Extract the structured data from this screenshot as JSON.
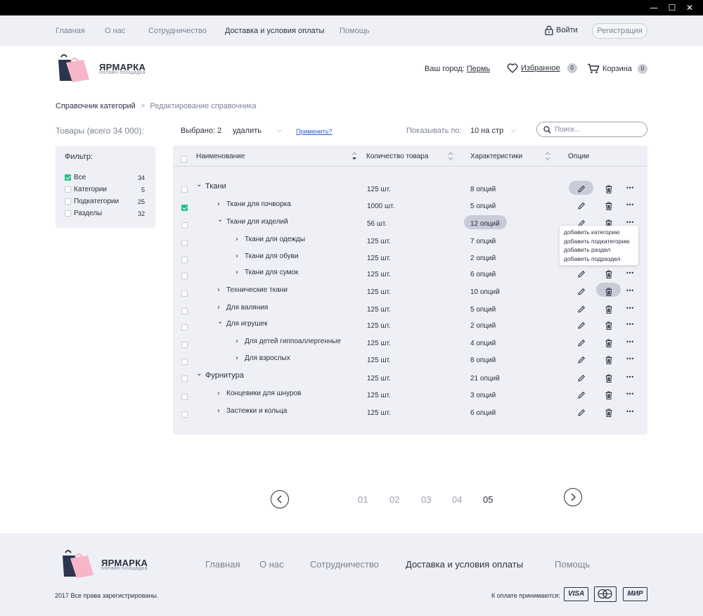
{
  "window": {
    "min_glyph": "—",
    "max_glyph": "☐",
    "close_glyph": "✕"
  },
  "topnav": {
    "items": [
      "Главная",
      "О нас",
      "Сотрудничество",
      "Доставка и условия оплаты",
      "Помощь"
    ],
    "active_index": 3,
    "login": "Войти",
    "register": "Регистрация"
  },
  "brand": {
    "name": "ЯРМАРКА",
    "tagline": "онлайн-площадка",
    "colors": {
      "pink": "#f7b6c8",
      "navy": "#2b3550"
    }
  },
  "header": {
    "city_label": "Ваш город:",
    "city": "Пермь",
    "favorites": "Избранное",
    "favorites_count": "0",
    "cart": "Корзина",
    "cart_count": "0"
  },
  "breadcrumb": {
    "root": "Справочник категорий",
    "current": "Редактирование справочника"
  },
  "toolbar": {
    "total": "Товары (всего 34 000):",
    "selected": "Выбрано: 2",
    "action": "удалить",
    "apply": "Применить?",
    "per_page_label": "Показывать по:",
    "per_page": "10 на стр",
    "search_placeholder": "Поиск..."
  },
  "filter": {
    "title": "Фильтр:",
    "items": [
      {
        "label": "Все",
        "count": "34",
        "checked": true
      },
      {
        "label": "Категории",
        "count": "5",
        "checked": false
      },
      {
        "label": "Подкатегории",
        "count": "25",
        "checked": false
      },
      {
        "label": "Разделы",
        "count": "32",
        "checked": false
      }
    ]
  },
  "table": {
    "headers": {
      "name": "Наименование",
      "quantity": "Количество  товара",
      "specs": "Характеристики",
      "options": "Опции"
    },
    "rows": [
      {
        "name": "Ткани",
        "qty": "125 шт.",
        "specs": "8 опций",
        "level": 0,
        "expanded": true,
        "checked": false
      },
      {
        "name": "Ткани для пэчворка",
        "qty": "1000 шт.",
        "specs": "5 опций",
        "level": 1,
        "expanded": false,
        "checked": true
      },
      {
        "name": "Ткани для изделий",
        "qty": "56 шт.",
        "specs": "12 опций",
        "level": 1,
        "expanded": true,
        "checked": false
      },
      {
        "name": "Ткани для одежды",
        "qty": "125 шт.",
        "specs": "7 опций",
        "level": 2,
        "expanded": false,
        "checked": false
      },
      {
        "name": "Ткани для обуви",
        "qty": "125 шт.",
        "specs": "2 опций",
        "level": 2,
        "expanded": false,
        "checked": false
      },
      {
        "name": "Ткани для сумок",
        "qty": "125 шт.",
        "specs": "6 опций",
        "level": 2,
        "expanded": false,
        "checked": false
      },
      {
        "name": "Технические ткани",
        "qty": "125 шт.",
        "specs": "10 опций",
        "level": 1,
        "expanded": false,
        "checked": false
      },
      {
        "name": "Для валяния",
        "qty": "125 шт.",
        "specs": "5 опций",
        "level": 1,
        "expanded": false,
        "checked": false
      },
      {
        "name": "Для игрушек",
        "qty": "125 шт.",
        "specs": "2 опций",
        "level": 1,
        "expanded": true,
        "checked": false
      },
      {
        "name": "Для детей гиппоаллергенные",
        "qty": "125 шт.",
        "specs": "4 опций",
        "level": 2,
        "expanded": false,
        "checked": false
      },
      {
        "name": "Для взрослых",
        "qty": "125 шт.",
        "specs": "8 опций",
        "level": 2,
        "expanded": false,
        "checked": false
      },
      {
        "name": "Фурнитура",
        "qty": "125 шт.",
        "specs": "21 опций",
        "level": 0,
        "expanded": true,
        "checked": false
      },
      {
        "name": "Концевики для шнуров",
        "qty": "125 шт.",
        "specs": "3 опций",
        "level": 1,
        "expanded": false,
        "checked": false
      },
      {
        "name": "Застежки и кольца",
        "qty": "125 шт.",
        "specs": "6 опций",
        "level": 1,
        "expanded": false,
        "checked": false
      }
    ],
    "dropdown": [
      "добавить категорию",
      "добавить подкатегорию",
      "добавить раздел",
      "добавить подраздел"
    ],
    "more_glyph": "•••"
  },
  "pagination": {
    "pages": [
      "01",
      "02",
      "03",
      "04",
      "05"
    ],
    "active_index": 4
  },
  "footer": {
    "nav": [
      "Главная",
      "О нас",
      "Сотрудничество",
      "Доставка и условия оплаты",
      "Помощь"
    ],
    "active_index": 3,
    "copyright": "2017 Все права зарегистрированы.",
    "payment_label": "К оплате принимаются:",
    "cards": [
      "VISA",
      "МИР"
    ]
  }
}
